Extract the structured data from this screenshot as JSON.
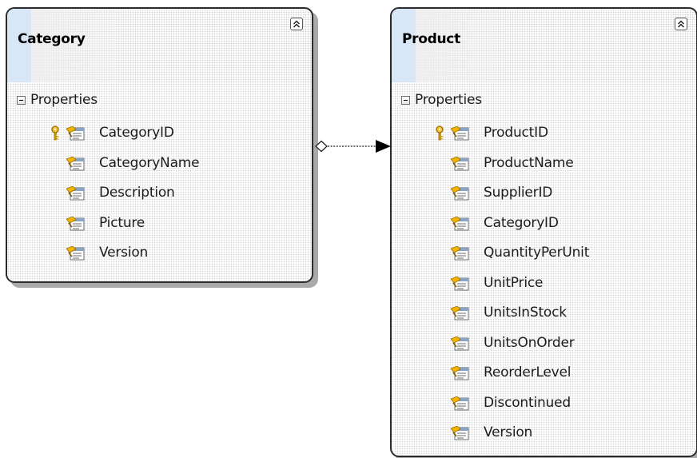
{
  "diagram": {
    "entities": [
      {
        "title": "Category",
        "section": "Properties",
        "properties": [
          {
            "name": "CategoryID",
            "key": true
          },
          {
            "name": "CategoryName",
            "key": false
          },
          {
            "name": "Description",
            "key": false
          },
          {
            "name": "Picture",
            "key": false
          },
          {
            "name": "Version",
            "key": false
          }
        ]
      },
      {
        "title": "Product",
        "section": "Properties",
        "properties": [
          {
            "name": "ProductID",
            "key": true
          },
          {
            "name": "ProductName",
            "key": false
          },
          {
            "name": "SupplierID",
            "key": false
          },
          {
            "name": "CategoryID",
            "key": false
          },
          {
            "name": "QuantityPerUnit",
            "key": false
          },
          {
            "name": "UnitPrice",
            "key": false
          },
          {
            "name": "UnitsInStock",
            "key": false
          },
          {
            "name": "UnitsOnOrder",
            "key": false
          },
          {
            "name": "ReorderLevel",
            "key": false
          },
          {
            "name": "Discontinued",
            "key": false
          },
          {
            "name": "Version",
            "key": false
          }
        ]
      }
    ],
    "association": {
      "from": "Category",
      "to": "Product",
      "source_end": "diamond",
      "target_end": "arrow"
    }
  },
  "icons": {
    "collapse": "chevron-double-up-icon",
    "section_expander": "minus-box-icon",
    "key": "key-icon",
    "property": "property-icon"
  },
  "colors": {
    "border": "#2b2b2b",
    "shadow": "#a9a9a9",
    "header_stripe": "#d8e6f5",
    "text": "#1c1c1c"
  }
}
